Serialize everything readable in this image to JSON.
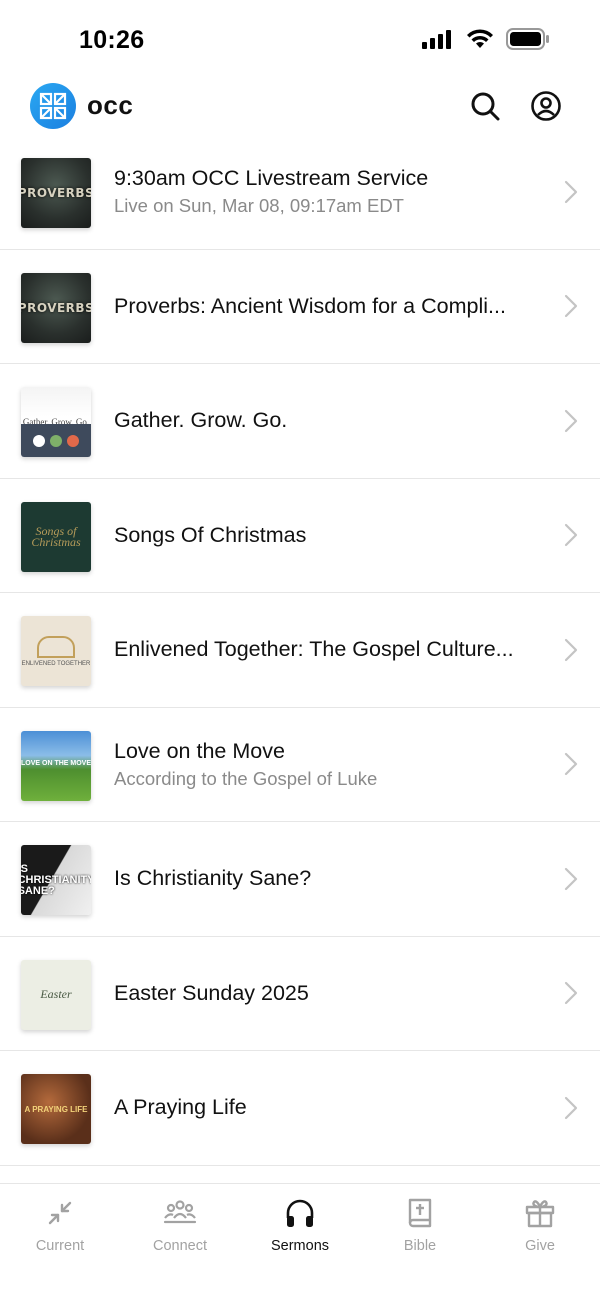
{
  "status_bar": {
    "time": "10:26"
  },
  "header": {
    "app_name": "occ",
    "logo_color": "#2196f3"
  },
  "sermons": [
    {
      "title": "9:30am OCC Livestream Service",
      "subtitle": "Live on Sun, Mar 08, 09:17am EDT",
      "thumb_text": "PROVERBS"
    },
    {
      "title": "Proverbs: Ancient Wisdom for a Compli...",
      "subtitle": "",
      "thumb_text": "PROVERBS"
    },
    {
      "title": "Gather. Grow. Go.",
      "subtitle": "",
      "thumb_text": "Gather. Grow. Go."
    },
    {
      "title": "Songs Of Christmas",
      "subtitle": "",
      "thumb_text": "Songs of Christmas"
    },
    {
      "title": "Enlivened Together: The Gospel Culture...",
      "subtitle": "",
      "thumb_text": "ENLIVENED TOGETHER"
    },
    {
      "title": "Love on the Move",
      "subtitle": "According to the Gospel of Luke",
      "thumb_text": "LOVE ON THE MOVE"
    },
    {
      "title": "Is Christianity Sane?",
      "subtitle": "",
      "thumb_text": "IS CHRISTIANITY SANE?"
    },
    {
      "title": "Easter Sunday 2025",
      "subtitle": "",
      "thumb_text": "Easter"
    },
    {
      "title": "A Praying Life",
      "subtitle": "",
      "thumb_text": "A PRAYING LIFE"
    }
  ],
  "tabs": [
    {
      "label": "Current",
      "icon": "arrows-in-icon",
      "active": false
    },
    {
      "label": "Connect",
      "icon": "group-icon",
      "active": false
    },
    {
      "label": "Sermons",
      "icon": "headphones-icon",
      "active": true
    },
    {
      "label": "Bible",
      "icon": "bible-icon",
      "active": false
    },
    {
      "label": "Give",
      "icon": "gift-icon",
      "active": false
    }
  ]
}
